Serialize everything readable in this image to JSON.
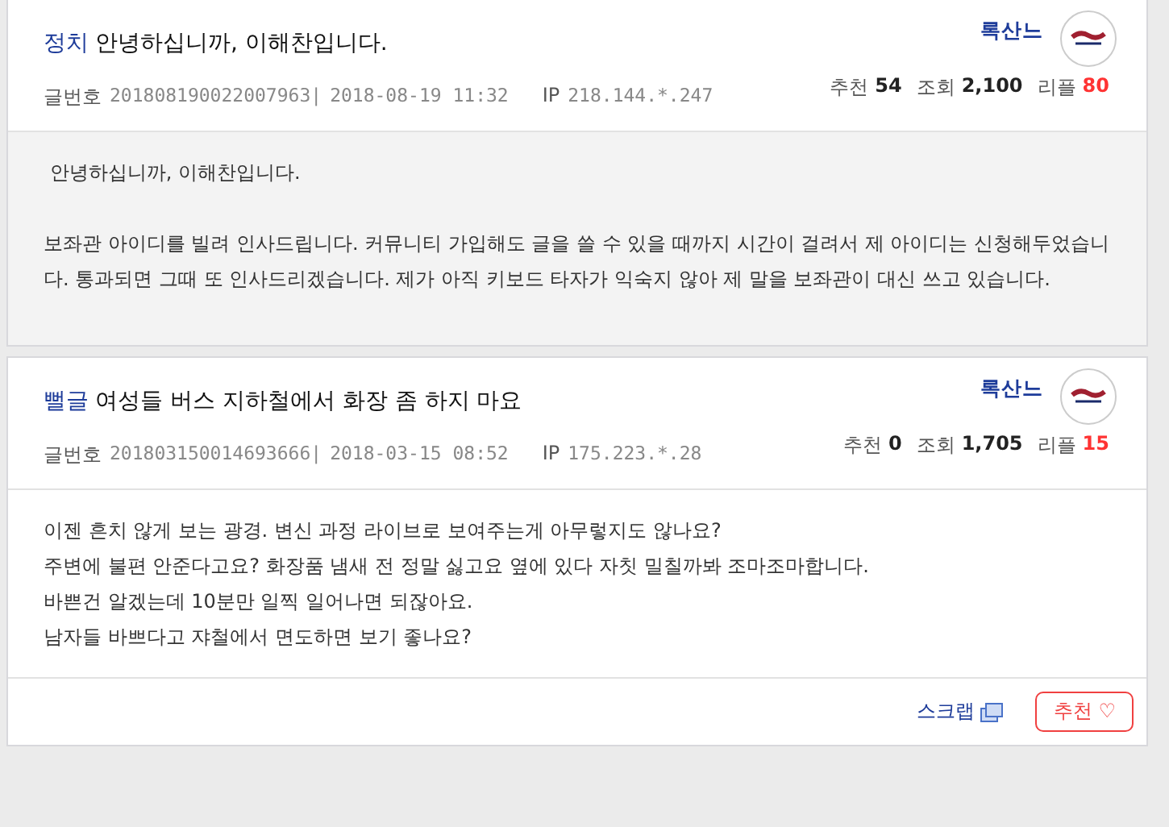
{
  "posts": [
    {
      "category": "정치",
      "title": "안녕하십니까, 이해찬입니다.",
      "author": "록산느",
      "meta": {
        "number_label": "글번호",
        "number": "201808190022007963|",
        "date": "2018-08-19 11:32",
        "ip_label": "IP",
        "ip": "218.144.*.247"
      },
      "stats": [
        {
          "label": "추천",
          "value": "54",
          "color": "#222222"
        },
        {
          "label": "조회",
          "value": "2,100",
          "color": "#222222"
        },
        {
          "label": "리플",
          "value": "80",
          "color": "#ff3333"
        }
      ],
      "shaded": true,
      "blocks": [
        [
          " 안녕하십니까, 이해찬입니다."
        ],
        [
          "보좌관 아이디를 빌려 인사드립니다. 커뮤니티 가입해도 글을 쓸 수 있을 때까지 시간이 걸려서 제 아이디는 신청해두었습니다. 통과되면 그때 또 인사드리겠습니다. 제가 아직 키보드 타자가 익숙지 않아 제 말을 보좌관이 대신 쓰고 있습니다."
        ]
      ]
    },
    {
      "category": "뻘글",
      "title": "여성들 버스 지하철에서 화장 좀 하지 마요",
      "author": "록산느",
      "meta": {
        "number_label": "글번호",
        "number": "201803150014693666|",
        "date": "2018-03-15 08:52",
        "ip_label": "IP",
        "ip": "175.223.*.28"
      },
      "stats": [
        {
          "label": "추천",
          "value": "0",
          "color": "#222222"
        },
        {
          "label": "조회",
          "value": "1,705",
          "color": "#222222"
        },
        {
          "label": "리플",
          "value": "15",
          "color": "#ff3333"
        }
      ],
      "shaded": false,
      "blocks": [
        [
          "이젠 흔치 않게 보는 광경. 변신 과정 라이브로 보여주는게 아무렇지도 않나요?",
          "주변에 불편 안준다고요? 화장품 냄새 전 정말 싫고요 옆에 있다 자칫 밀칠까봐 조마조마합니다.",
          "바쁜건 알겠는데 10분만 일찍 일어나면 되잖아요.",
          "남자들 바쁘다고 쟈철에서 면도하면 보기 좋나요?"
        ]
      ],
      "footer": {
        "scrap": "스크랩",
        "recommend": "추천",
        "recommend_icon": "♡"
      }
    }
  ]
}
